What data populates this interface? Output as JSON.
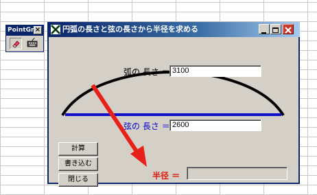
{
  "toolbar": {
    "title": "PointGr",
    "close_glyph": "×",
    "buttons": [
      {
        "icon": "eraser-icon"
      },
      {
        "icon": "keyboard-icon"
      }
    ]
  },
  "window": {
    "title": "円弧の長さと弦の長さから半径を求める",
    "controls": {
      "minimize": "minimize-icon",
      "maximize": "maximize-icon",
      "close": "close-icon"
    }
  },
  "form": {
    "arc_label": "弧の 長さ ＝",
    "arc_value": "3100",
    "chord_label": "弦の 長さ ＝",
    "chord_value": "2600",
    "radius_label": "半径 ＝",
    "radius_value": ""
  },
  "buttons": {
    "calculate": "計算",
    "write": "書き込む",
    "close": "閉じる"
  },
  "colors": {
    "arc": "#000000",
    "chord": "#1010c8",
    "chord_label": "#0000d0",
    "arrow": "#e8201a",
    "radius_label": "#e02010",
    "title_bar_start": "#0a246a",
    "window_face": "#d4d0c8"
  }
}
